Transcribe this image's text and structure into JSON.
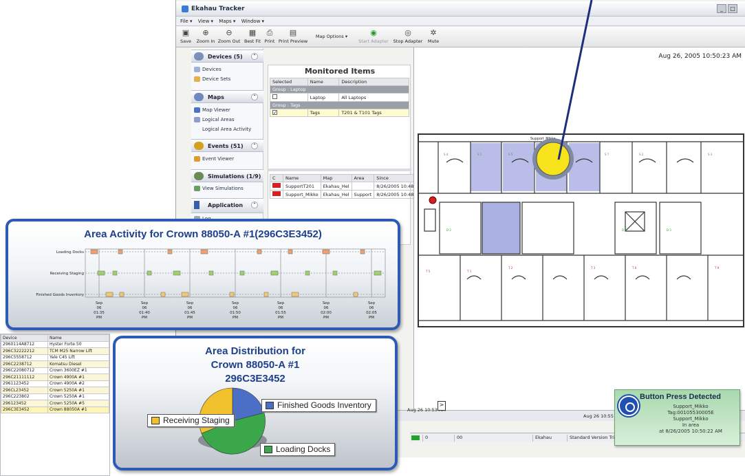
{
  "window": {
    "title": "Ekahau Tracker",
    "menu": [
      "File ▾",
      "View ▾",
      "Maps ▾",
      "Window ▾"
    ],
    "toolbar": [
      "Save",
      "Zoom In",
      "Zoom Out",
      "Best Fit",
      "Print",
      "Print Preview",
      "Map Options ▾",
      "Start Adapter",
      "Stop Adapter",
      "Mute"
    ]
  },
  "nav": {
    "devices_header": "Devices (5)",
    "devices_items": [
      "Devices",
      "Device Sets"
    ],
    "maps_header": "Maps",
    "maps_items": [
      "Map Viewer",
      "Logical Areas",
      "Logical Area Activity"
    ],
    "events_header": "Events (51)",
    "events_items": [
      "Event Viewer"
    ],
    "simulations_header": "Simulations (1/9)",
    "simulations_items": [
      "View Simulations"
    ],
    "application_header": "Application",
    "application_items": [
      "Log"
    ]
  },
  "monitored": {
    "title": "Monitored Items",
    "columns": [
      "Selected",
      "Name",
      "Description"
    ],
    "group1": "Group : Laptop",
    "row1": {
      "name": "Laptop",
      "desc": "All Laptops"
    },
    "group2": "Group : Tags",
    "row2": {
      "name": "Tags",
      "desc": "T201 & T101 Tags"
    },
    "lower_columns": [
      "C",
      "Name",
      "Map",
      "Area",
      "Since"
    ],
    "lower_rows": [
      {
        "name": "SupportT201",
        "map": "Ekahau_Hel",
        "area": "",
        "since": "8/26/2005 10:48:59"
      },
      {
        "name": "Support_Mikko",
        "map": "Ekahau_Hel",
        "area": "Support",
        "since": "8/26/2005 10:48:59"
      }
    ]
  },
  "map": {
    "timestamp": "Aug 26, 2005 10:50:23 AM",
    "room_label": "Support_Mikko",
    "timeline_left": "Aug 26 10:53 AM",
    "timeline_right": "Aug 26 10:55 AM",
    "status": [
      "0",
      "00",
      "Ekahau",
      "Standard Version Tri"
    ]
  },
  "activity": {
    "title": "Area Activity for Crown 88050-A #1(296C3E3452)",
    "rows": [
      "Loading Docks",
      "Receiving Staging",
      "Finished Goods Inventory"
    ],
    "ticks": [
      [
        "Sep",
        "06",
        "01:35",
        "PM"
      ],
      [
        "Sep",
        "06",
        "01:40",
        "PM"
      ],
      [
        "Sep",
        "06",
        "01:45",
        "PM"
      ],
      [
        "Sep",
        "06",
        "01:50",
        "PM"
      ],
      [
        "Sep",
        "06",
        "01:55",
        "PM"
      ],
      [
        "Sep",
        "06",
        "02:00",
        "PM"
      ],
      [
        "Sep",
        "06",
        "02:05",
        "PM"
      ]
    ]
  },
  "devices": {
    "columns": [
      "Device",
      "Name"
    ],
    "rows": [
      [
        "2960114A8712",
        "Hyster Forte 50"
      ],
      [
        "296C32222212",
        "TCM M25 Narrow Lift"
      ],
      [
        "296C5558712",
        "Yale C45 Lift"
      ],
      [
        "296C2238712",
        "Komatsu Diesel"
      ],
      [
        "296C22080712",
        "Crown 3600EZ #1"
      ],
      [
        "296C21111112",
        "Crown 4900A #1"
      ],
      [
        "2961123452",
        "Crown 4900A #2"
      ],
      [
        "296CL23452",
        "Crown 5250A #1"
      ],
      [
        "296C223802",
        "Crown 5250A #1"
      ],
      [
        "296123452",
        "Crown 5250A #5"
      ],
      [
        "296C3E3452",
        "Crown 88050A #1"
      ]
    ]
  },
  "distribution": {
    "title_lines": [
      "Area Distribution for",
      "Crown 88050-A #1",
      "296C3E3452"
    ],
    "legend": {
      "finished": "Finished Goods Inventory",
      "receiving": "Receiving Staging",
      "loading": "Loading Docks"
    },
    "colors": {
      "finished": "#4a6fc4",
      "receiving": "#f2c12e",
      "loading": "#3aa74a"
    }
  },
  "notification": {
    "title": "Button Press Detected",
    "lines": [
      "Support_Mikko",
      "Tag:00105530005E",
      "Support_Mikko",
      "In area",
      "at 8/26/2005 10:50:22 AM"
    ]
  },
  "colors": {
    "accent": "#2b5bb5",
    "title_blue": "#1e3f8c",
    "marker_yellow": "#f6e31c"
  }
}
